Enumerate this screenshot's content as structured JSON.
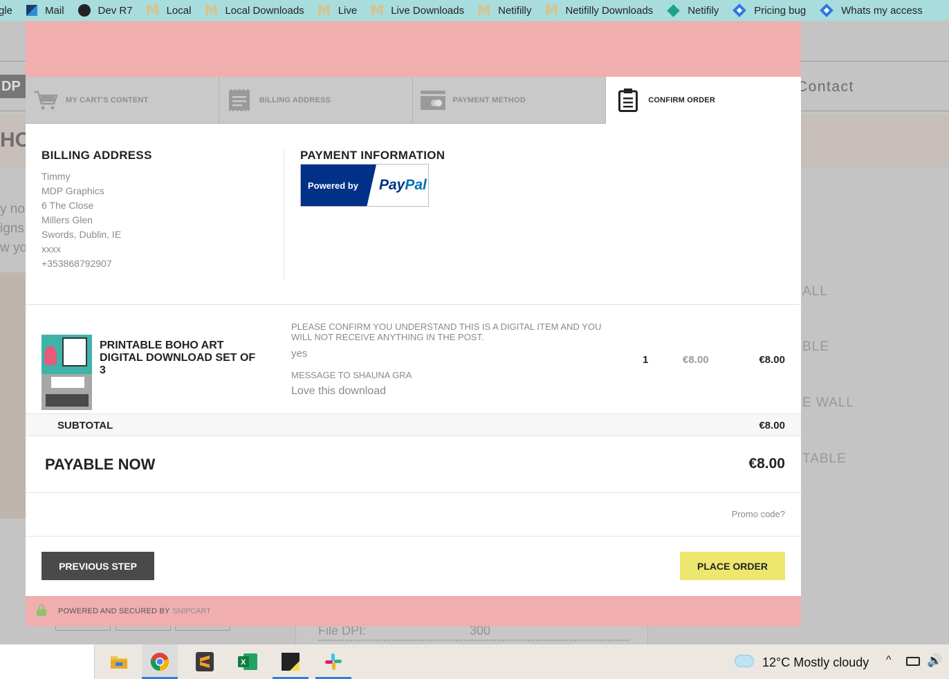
{
  "bookmarks": [
    {
      "label": "gle",
      "icon": "none"
    },
    {
      "label": "Mail",
      "icon": "mail-icon"
    },
    {
      "label": "Dev R7",
      "icon": "globe-icon"
    },
    {
      "label": "Local",
      "icon": "m-logo-icon"
    },
    {
      "label": "Local Downloads",
      "icon": "m-logo-icon"
    },
    {
      "label": "Live",
      "icon": "m-logo-icon"
    },
    {
      "label": "Live Downloads",
      "icon": "m-logo-icon"
    },
    {
      "label": "Netifilly",
      "icon": "m-logo-icon"
    },
    {
      "label": "Netifilly Downloads",
      "icon": "m-logo-icon"
    },
    {
      "label": "Netifily",
      "icon": "teal-diamond-icon"
    },
    {
      "label": "Pricing bug",
      "icon": "blue-diamond-icon"
    },
    {
      "label": "Whats my access",
      "icon": "blue-diamond-icon"
    }
  ],
  "background": {
    "nav_contact": "Contact",
    "hero_fragment": "HO",
    "side_text": [
      "y no",
      "igns",
      "w yo"
    ],
    "right_text": [
      "ALL",
      "BLE",
      "E WALL",
      "TABLE"
    ],
    "file_dpi_label": "File DPI:",
    "file_dpi_value": "300"
  },
  "steps": [
    {
      "label": "MY CART'S CONTENT",
      "icon": "cart-icon",
      "active": false
    },
    {
      "label": "BILLING ADDRESS",
      "icon": "receipt-icon",
      "active": false
    },
    {
      "label": "PAYMENT METHOD",
      "icon": "credit-card-icon",
      "active": false
    },
    {
      "label": "CONFIRM ORDER",
      "icon": "clipboard-icon",
      "active": true
    }
  ],
  "billing": {
    "title": "BILLING ADDRESS",
    "lines": [
      "Timmy",
      "MDP Graphics",
      "6 The Close",
      "Millers Glen",
      "Swords, Dublin, IE",
      "xxxx",
      "+353868792907"
    ]
  },
  "payment": {
    "title": "PAYMENT INFORMATION",
    "badge_prefix": "Powered by",
    "badge_brand_a": "Pay",
    "badge_brand_b": "Pal"
  },
  "item": {
    "name": "PRINTABLE BOHO ART DIGITAL DOWNLOAD SET OF 3",
    "question1": "PLEASE CONFIRM YOU UNDERSTAND THIS IS A DIGITAL ITEM AND YOU WILL NOT RECEIVE ANYTHING IN THE POST.",
    "answer1": "yes",
    "question2": "MESSAGE TO SHAUNA GRA",
    "answer2": "Love this download",
    "quantity": "1",
    "unit_price": "€8.00",
    "total": "€8.00"
  },
  "subtotal": {
    "label": "SUBTOTAL",
    "value": "€8.00"
  },
  "payable": {
    "label": "PAYABLE NOW",
    "value": "€8.00"
  },
  "promo_label": "Promo code?",
  "buttons": {
    "previous": "PREVIOUS STEP",
    "place_order": "PLACE ORDER"
  },
  "footer": {
    "text": "POWERED AND SECURED BY",
    "brand": "SNIPCART"
  },
  "taskbar": {
    "apps": [
      "file-explorer-icon",
      "chrome-icon",
      "sublime-text-icon",
      "excel-icon",
      "sticky-notes-icon",
      "slack-icon"
    ],
    "weather": "12°C  Mostly cloudy"
  },
  "colors": {
    "modal_accent": "#f0aeae",
    "place_order": "#ede770",
    "previous": "#4a4a4a",
    "bookmarks_bar": "#a9dcdc"
  }
}
